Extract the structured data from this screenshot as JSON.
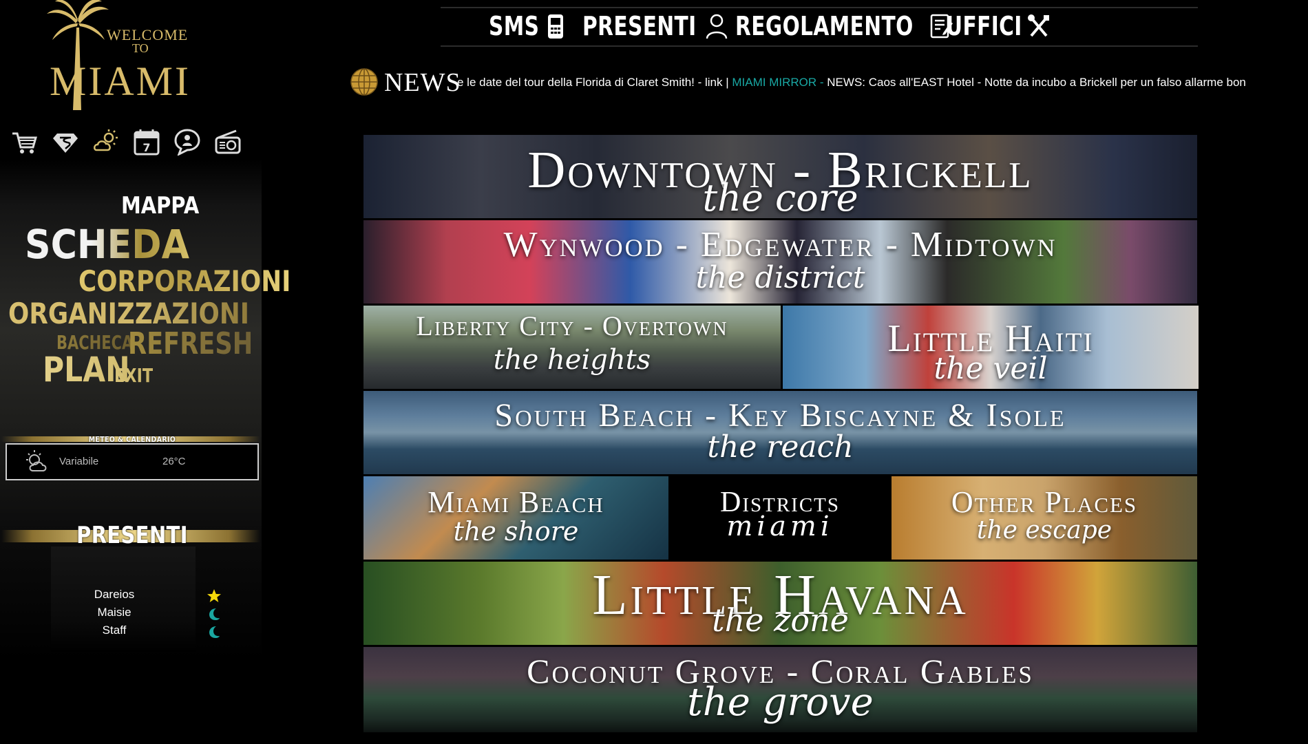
{
  "logo": {
    "line1": "WELCOME",
    "line2": "TO",
    "line3": "MIAMI",
    "color": "#d8bb6a"
  },
  "toolbar": {
    "icons": [
      "shopping-cart-icon",
      "superman-shield-icon",
      "sun-cloud-icon",
      "calendar-icon",
      "chat-bubble-icon",
      "radio-icon"
    ],
    "calendar_day": "7"
  },
  "menu": {
    "mappa": "MAPPA",
    "scheda": "SCHEDA",
    "corporazioni": "CORPORAZIONI",
    "organizzazioni": "ORGANIZZAZIONI",
    "bacheca": "BACHECA",
    "refresh": "REFRESH",
    "plan": "PLAN",
    "exit": "EXIT"
  },
  "meteo": {
    "title": "METEO & CALENDARIO",
    "condition": "Variabile",
    "temperature": "26°C"
  },
  "presenti": {
    "title": "PRESENTI",
    "users": [
      {
        "name": "Dareios",
        "status": "star",
        "status_color": "#f5d90a"
      },
      {
        "name": "Maisie",
        "status": "moon",
        "status_color": "#1aa6a0"
      },
      {
        "name": "Staff",
        "status": "moon",
        "status_color": "#1aa6a0"
      }
    ]
  },
  "nav": {
    "sms": "SMS",
    "presenti": "PRESENTI",
    "regolamento": "REGOLAMENTO",
    "uffici": "UFFICI"
  },
  "news": {
    "label": "NEWS",
    "text_a": "e le date del tour della Florida di Claret Smith! - link | ",
    "source": "MIAMI MIRROR - ",
    "text_b": "NEWS: Caos all'EAST Hotel - Notte da incubo a Brickell per un falso allarme bon",
    "source_color": "#19a8a4"
  },
  "districts": {
    "downtown": {
      "title": "Downtown - Brickell",
      "subtitle": "the core"
    },
    "wynwood": {
      "title": "Wynwood - Edgewater - Midtown",
      "subtitle": "the district"
    },
    "liberty": {
      "title": "Liberty City - Overtown",
      "subtitle": "the heights"
    },
    "haiti": {
      "title": "Little Haiti",
      "subtitle": "the veil"
    },
    "south": {
      "title": "South Beach - Key Biscayne & Isole",
      "subtitle": "the reach"
    },
    "miamibeach": {
      "title": "Miami Beach",
      "subtitle": "the shore"
    },
    "districts_label": {
      "title": "Districts",
      "subtitle": "miami"
    },
    "other": {
      "title": "Other Places",
      "subtitle": "the escape"
    },
    "havana": {
      "title": "Little Havana",
      "subtitle": "the zone"
    },
    "coconut": {
      "title": "Coconut Grove - Coral Gables",
      "subtitle": "the grove"
    }
  }
}
